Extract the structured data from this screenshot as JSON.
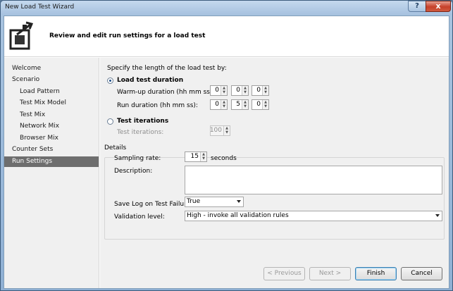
{
  "window": {
    "title": "New Load Test Wizard",
    "help": "?",
    "close": "x"
  },
  "header": {
    "title": "Review and edit run settings for a load test"
  },
  "nav": {
    "items": [
      {
        "label": "Welcome"
      },
      {
        "label": "Scenario"
      },
      {
        "label": "Load Pattern"
      },
      {
        "label": "Test Mix Model"
      },
      {
        "label": "Test Mix"
      },
      {
        "label": "Network Mix"
      },
      {
        "label": "Browser Mix"
      },
      {
        "label": "Counter Sets"
      },
      {
        "label": "Run Settings"
      }
    ]
  },
  "run": {
    "prompt": "Specify the length of the load test by:",
    "duration_option": "Load test duration",
    "warmup_label": "Warm-up duration (hh mm ss):",
    "warmup": {
      "hh": "0",
      "mm": "0",
      "ss": "0"
    },
    "run_label": "Run duration (hh mm ss):",
    "run": {
      "hh": "0",
      "mm": "5",
      "ss": "0"
    },
    "iterations_option": "Test iterations",
    "iterations_label": "Test iterations:",
    "iterations_value": "100"
  },
  "details": {
    "legend": "Details",
    "sampling_label": "Sampling rate:",
    "sampling_value": "15",
    "sampling_unit": "seconds",
    "description_label": "Description:",
    "description_value": "",
    "savelog_label": "Save Log on Test Failure:",
    "savelog_value": "True",
    "validation_label": "Validation level:",
    "validation_value": "High - invoke all validation rules"
  },
  "buttons": {
    "previous": "< Previous",
    "next": "Next >",
    "finish": "Finish",
    "cancel": "Cancel"
  }
}
